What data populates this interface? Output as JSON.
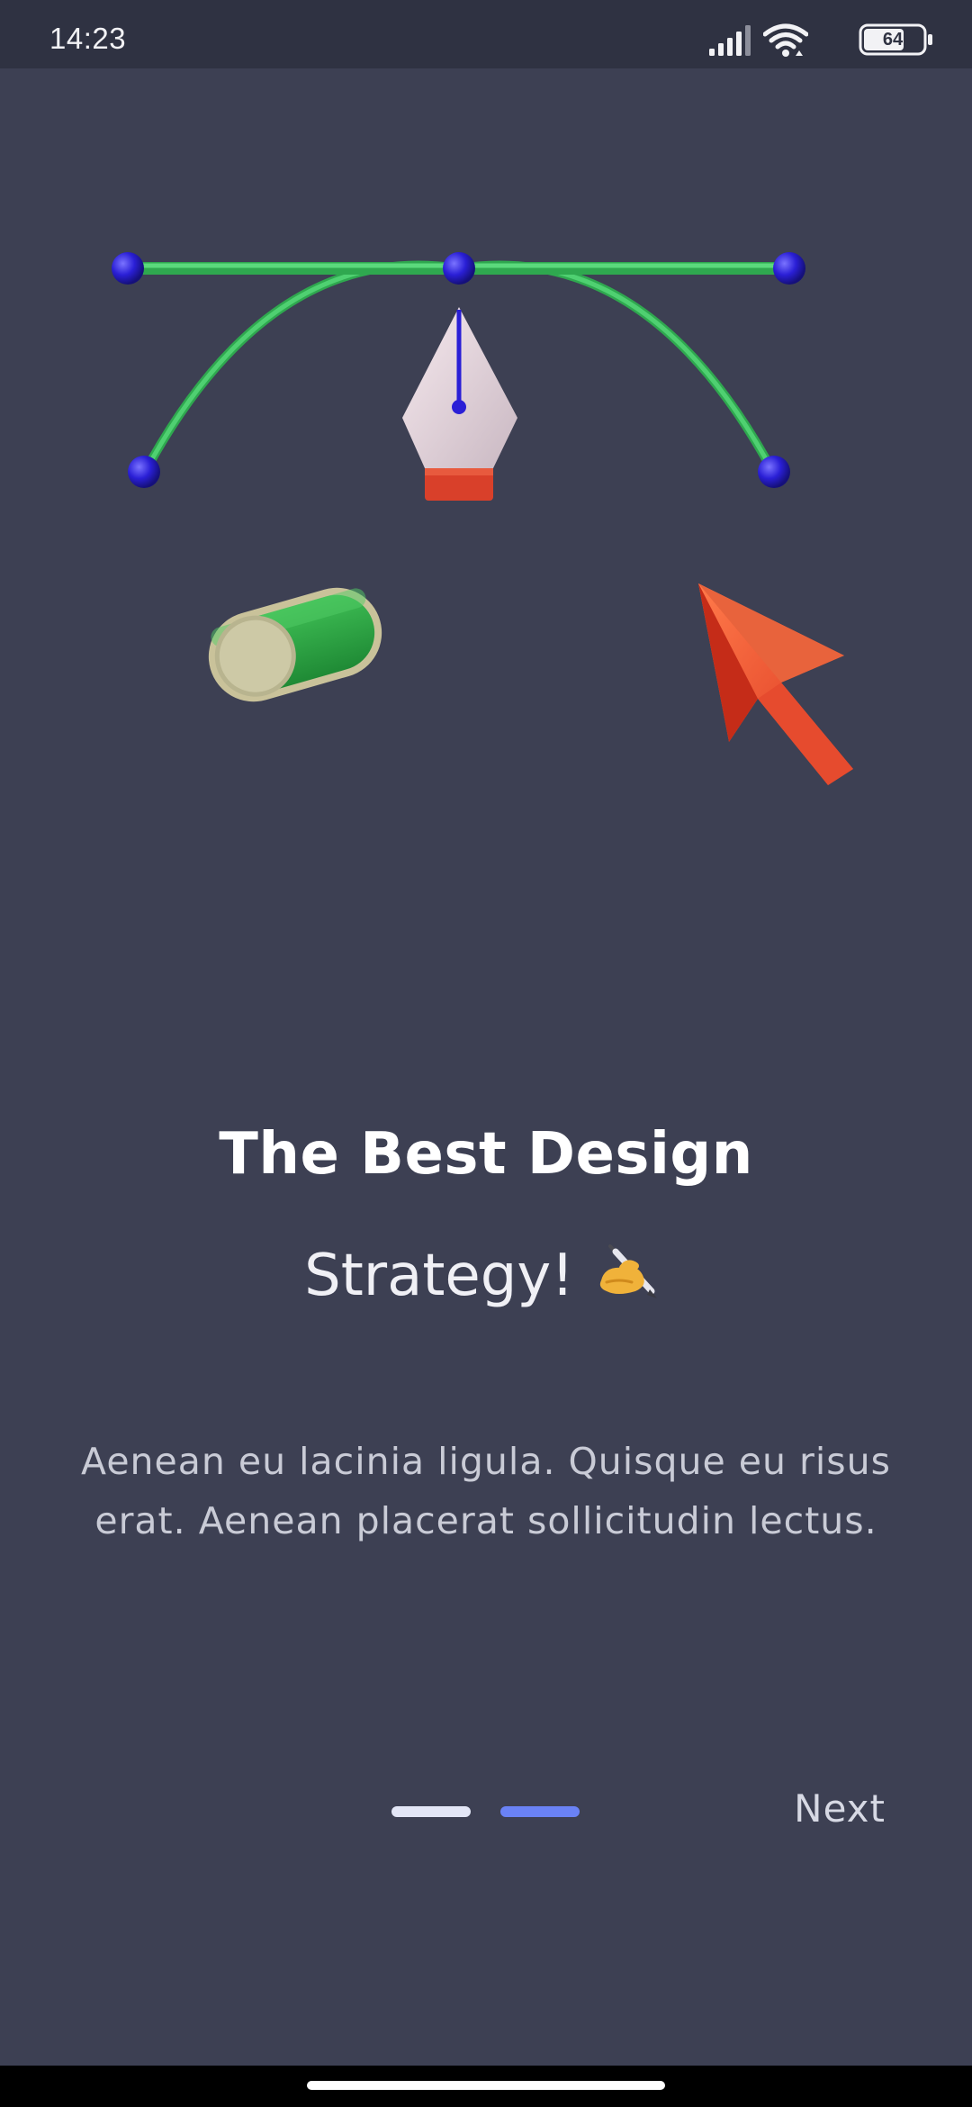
{
  "status_bar": {
    "time": "14:23",
    "battery_level": "64",
    "icons": [
      "signal-icon",
      "wifi-icon",
      "battery-icon"
    ]
  },
  "illustration": {
    "items": [
      "bezier-pen-tool-icon",
      "toggle-switch-icon",
      "cursor-arrow-icon"
    ]
  },
  "onboarding": {
    "title_line1": "The Best Design",
    "title_line2": "Strategy!",
    "title_emoji_icon": "writing-hand-icon",
    "description": "Aenean eu lacinia ligula. Quisque eu risus erat. Aenean placerat sollicitudin lectus."
  },
  "pager": {
    "page_count": 2,
    "active_index": 1,
    "next_label": "Next"
  },
  "colors": {
    "background": "#3d4053",
    "status_bar": "#2f3242",
    "indicator_inactive": "#e3e6f6",
    "indicator_active": "#6a82f5"
  }
}
